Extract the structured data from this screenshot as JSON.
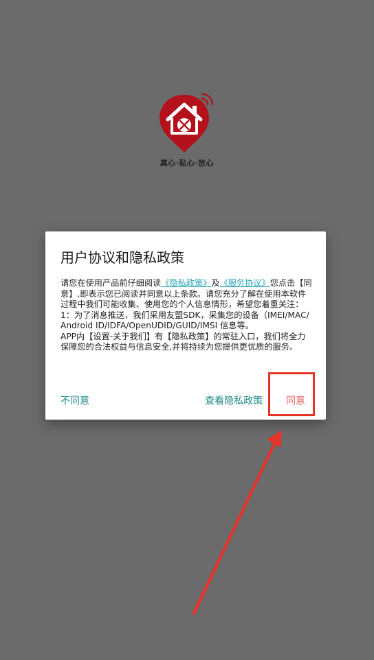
{
  "splash": {
    "slogan": "真心·贴心·放心",
    "logo_icon": "house-tools-pin-icon",
    "logo_color": "#b3121c"
  },
  "dialog": {
    "title": "用户协议和隐私政策",
    "body": {
      "intro_pre": "请您在使用产品前仔细阅读",
      "privacy_link": "《隐私政策》",
      "and": "及",
      "service_link": "《服务协议》",
      "intro_post": "您点击【同意】,即表示您已阅读并同意以上条款。请您充分了解在使用本软件过程中我们可能收集、使用您的个人信息情形，希望您着重关注：",
      "item1": "1：为了消息推送，我们采用友盟SDK，采集您的设备（IMEI/MAC/Android ID/IDFA/OpenUDID/GUID/IMSI 信息等。",
      "item2": "APP内【设置-关于我们】有【隐私政策】的常驻入口，我们将全力保障您的合法权益与信息安全,并将持续为您提供更优质的服务。"
    },
    "buttons": {
      "disagree": "不同意",
      "view_policy": "查看隐私政策",
      "agree": "同意"
    }
  },
  "colors": {
    "overlay": "#6b6b6b",
    "link": "#2aa6b8",
    "button_teal": "#1e8a86",
    "agree_red": "#e05a5a",
    "annotation_red": "#e8322a"
  }
}
